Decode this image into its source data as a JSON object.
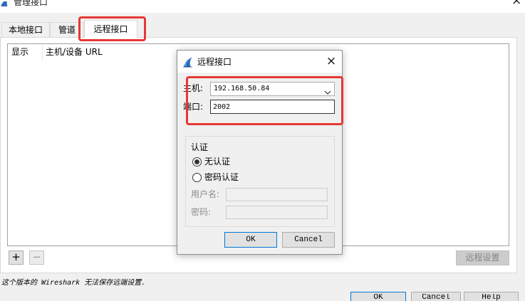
{
  "window": {
    "title": "管理接口",
    "close_glyph": "×",
    "app_icon": "wireshark-fin-icon"
  },
  "tabs": [
    {
      "label": "本地接口",
      "active": false
    },
    {
      "label": "管道",
      "active": false
    },
    {
      "label": "远程接口",
      "active": true
    }
  ],
  "interface_table": {
    "columns": [
      "显示",
      "主机/设备 URL"
    ]
  },
  "toolbar": {
    "add_label": "+",
    "remove_label": "−",
    "remote_settings_label": "远程设置"
  },
  "status_text": "这个版本的 Wireshark 无法保存远端设置.",
  "dialog_buttons": {
    "ok": "OK",
    "cancel": "Cancel",
    "help": "Help"
  },
  "remote_dialog": {
    "title": "远程接口",
    "close_glyph": "×",
    "app_icon": "wireshark-fin-icon",
    "host": {
      "label": "主机:",
      "value": "192.168.50.84",
      "icon": "chevron-down-icon"
    },
    "port": {
      "label": "端口:",
      "value": "2002"
    },
    "auth": {
      "title": "认证",
      "options": [
        {
          "label": "无认证",
          "checked": true
        },
        {
          "label": "密码认证",
          "checked": false
        }
      ],
      "username": {
        "label": "用户名:",
        "value": ""
      },
      "password": {
        "label": "密码:",
        "value": ""
      }
    },
    "ok_label": "OK",
    "cancel_label": "Cancel"
  },
  "colors": {
    "annotation_red": "#e53935",
    "default_button_border": "#0078d7",
    "wireshark_blue": "#2a6fbd",
    "window_bg": "#f0f0f0"
  }
}
